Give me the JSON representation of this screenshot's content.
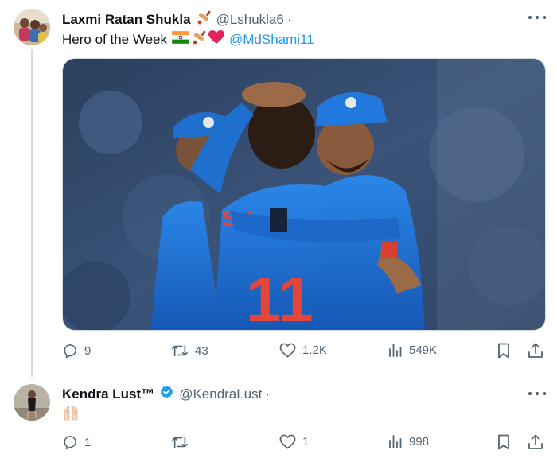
{
  "tweets": [
    {
      "author_name": "Laxmi Ratan Shukla",
      "author_handle": "@Lshukla6",
      "separator": "·",
      "text": "Hero of the Week",
      "text_emojis": [
        "flag-india-icon",
        "cricket-bat-icon",
        "red-heart-icon"
      ],
      "mention": "@MdShami11",
      "media_description_icons": [
        "team-huddle-photo"
      ],
      "actions": {
        "replies": "9",
        "reposts": "43",
        "likes": "1.2K",
        "views": "549K"
      }
    },
    {
      "author_name": "Kendra Lust™",
      "author_handle": "@KendraLust",
      "separator": "·",
      "verified": true,
      "text_emojis": [
        "raised-hands-icon"
      ],
      "actions": {
        "replies": "1",
        "reposts": "",
        "likes": "1",
        "views": "998"
      }
    }
  ],
  "colors": {
    "text_primary": "#0f1419",
    "text_secondary": "#536471",
    "link": "#1d9bf0",
    "verified": "#1d9bf0",
    "divider": "#cfd9de",
    "jersey_blue": "#1f6fcf"
  }
}
